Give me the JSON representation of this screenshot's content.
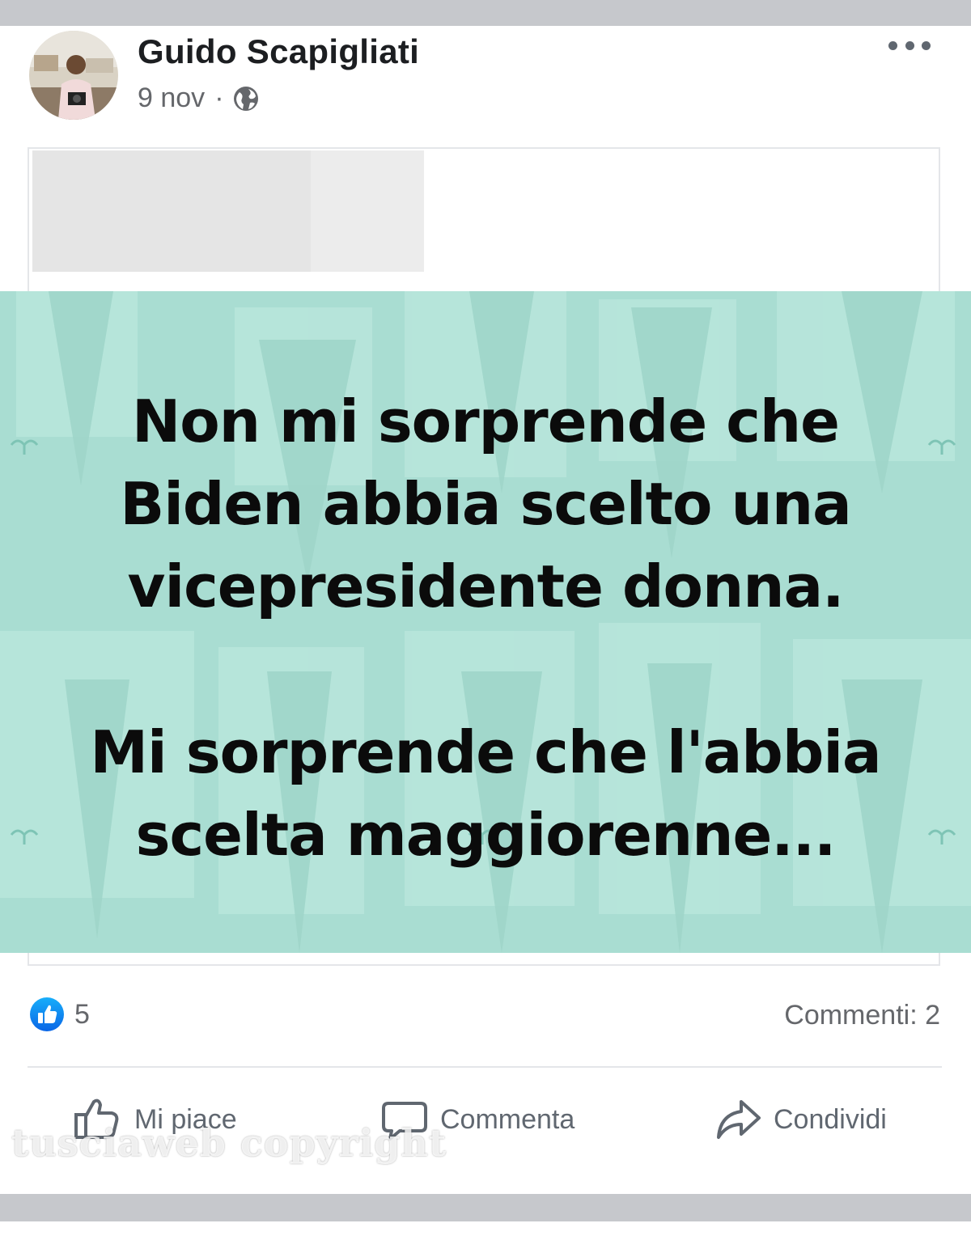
{
  "post": {
    "author": "Guido Scapigliati",
    "date": "9 nov",
    "separator": "·",
    "audience_icon": "globe-icon",
    "more_icon": "more-options-icon",
    "image_text": {
      "lines_1": [
        "Non mi sorprende che",
        "Biden abbia scelto una",
        "vicepresidente donna."
      ],
      "lines_2": [
        "Mi sorprende che l'abbia",
        "scelta maggiorenne..."
      ]
    },
    "image_background_color": "#a9ddd2"
  },
  "reactions": {
    "like_count": "5",
    "comments": "Commenti: 2",
    "like_badge_color": "#1877f2"
  },
  "actions": {
    "like": "Mi piace",
    "comment": "Commenta",
    "share": "Condividi"
  },
  "watermark": "tusciaweb copyright"
}
